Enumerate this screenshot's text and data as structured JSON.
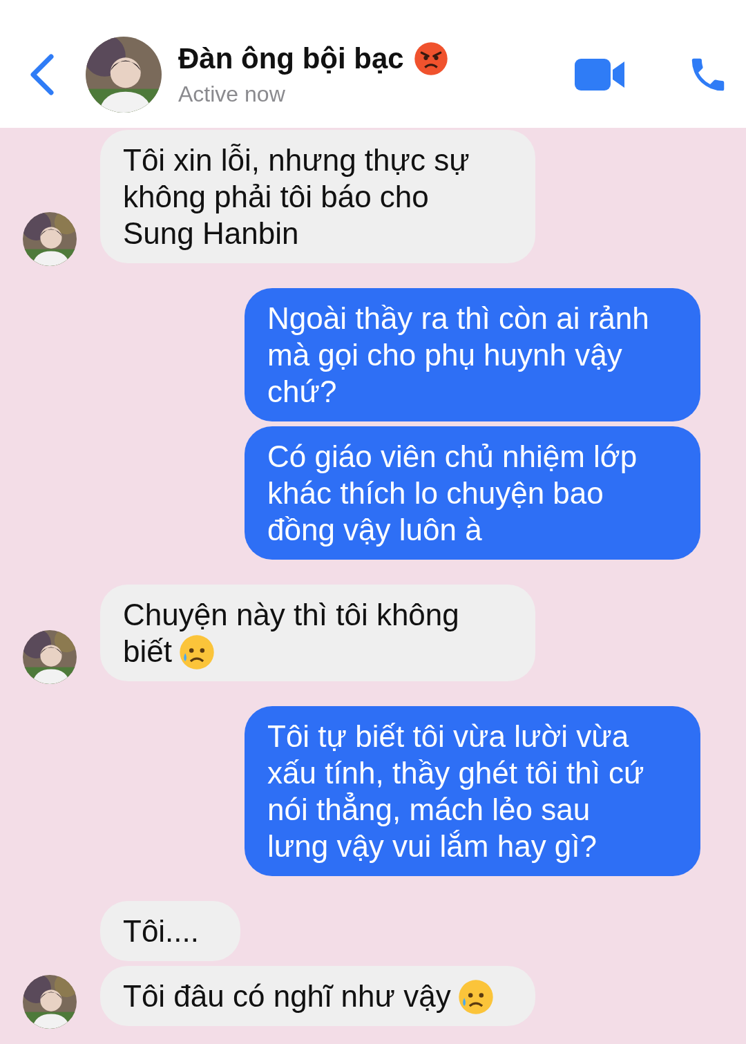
{
  "header": {
    "title": "Đàn ông bội bạc",
    "status": "Active now"
  },
  "groups": [
    {
      "kind": "incoming",
      "messages": [
        {
          "kind": "text",
          "text": "Tôi xin lỗi, nhưng thực sự không phải tôi báo cho Sung Hanbin"
        }
      ]
    },
    {
      "kind": "outgoing",
      "messages": [
        {
          "kind": "text",
          "text": "Ngoài thầy ra thì còn ai rảnh mà gọi cho phụ huynh vậy chứ?"
        },
        {
          "kind": "text",
          "text": "Có giáo viên chủ nhiệm lớp khác thích lo chuyện bao đồng vậy luôn à"
        }
      ]
    },
    {
      "kind": "incoming",
      "messages": [
        {
          "kind": "text_with_emoji",
          "text": "Chuyện này thì tôi không biết"
        }
      ]
    },
    {
      "kind": "outgoing",
      "messages": [
        {
          "kind": "text",
          "text": "Tôi tự biết tôi vừa lười vừa xấu tính, thầy ghét tôi thì cứ nói thẳng, mách lẻo sau lưng vậy vui lắm hay gì?"
        }
      ]
    },
    {
      "kind": "incoming",
      "messages": [
        {
          "kind": "text",
          "text": "Tôi...."
        },
        {
          "kind": "text_with_emoji",
          "text": "Tôi đâu có nghĩ như vậy"
        }
      ]
    }
  ]
}
